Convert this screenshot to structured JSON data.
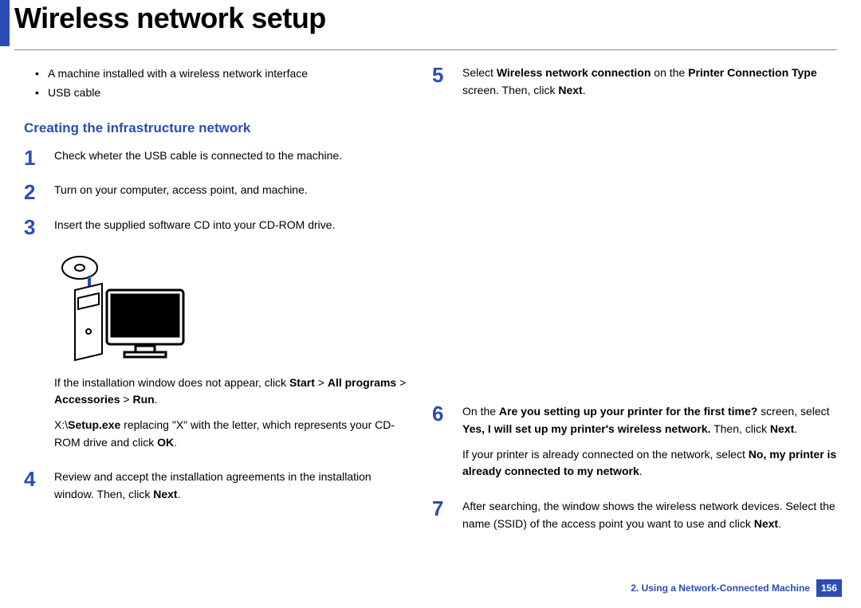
{
  "title": "Wireless network setup",
  "intro_bullets": [
    "A machine installed with a wireless network interface",
    "USB cable"
  ],
  "section_heading": "Creating the infrastructure network",
  "steps": {
    "s1": "Check wheter the USB cable is connected to the machine.",
    "s2": "Turn on your computer, access point, and machine.",
    "s3": "Insert the supplied software CD into your CD-ROM drive.",
    "s3_p1_a": "If the installation window does not appear, click ",
    "s3_p1_b": "Start",
    "s3_p1_c": " > ",
    "s3_p1_d": "All programs",
    "s3_p1_e": " > ",
    "s3_p1_f": "Accessories",
    "s3_p1_g": " > ",
    "s3_p1_h": "Run",
    "s3_p1_i": ".",
    "s3_p2_a": "X:\\",
    "s3_p2_b": "Setup.exe",
    "s3_p2_c": " replacing \"X\" with the letter, which represents your CD-ROM drive and click ",
    "s3_p2_d": "OK",
    "s3_p2_e": ".",
    "s4_a": "Review and accept the installation agreements in the installation window. Then, click ",
    "s4_b": "Next",
    "s4_c": ".",
    "s5_a": "Select ",
    "s5_b": "Wireless network connection",
    "s5_c": " on the ",
    "s5_d": "Printer Connection Type",
    "s5_e": " screen. Then, click ",
    "s5_f": "Next",
    "s5_g": ".",
    "s6_a": "On the ",
    "s6_b": "Are you setting up your printer for the first time?",
    "s6_c": " screen, select ",
    "s6_d": "Yes, I will set up my printer's wireless network.",
    "s6_e": " Then, click ",
    "s6_f": "Next",
    "s6_g": ".",
    "s6_p2_a": "If your printer is already connected on the network, select ",
    "s6_p2_b": "No, my printer is already connected to my network",
    "s6_p2_c": ".",
    "s7_a": "After searching, the window shows the wireless network devices. Select the name (SSID) of the access point you want to use and click ",
    "s7_b": "Next",
    "s7_c": "."
  },
  "footer": {
    "chapter": "2.  Using a Network-Connected Machine",
    "page": "156"
  }
}
